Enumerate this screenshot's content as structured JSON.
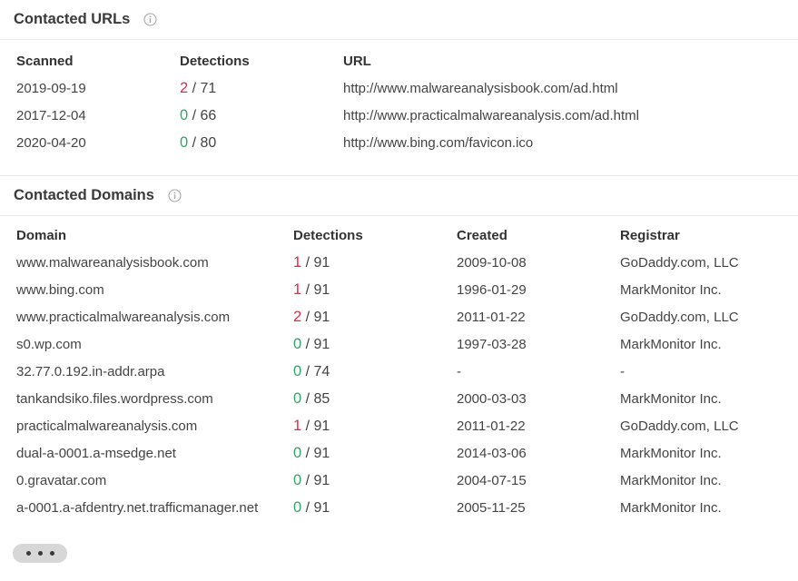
{
  "contacted_urls": {
    "title": "Contacted URLs",
    "headers": {
      "scanned": "Scanned",
      "detections": "Detections",
      "url": "URL"
    },
    "rows": [
      {
        "scanned": "2019-09-19",
        "positives": "2",
        "total": "71",
        "url": "http://www.malwareanalysisbook.com/ad.html"
      },
      {
        "scanned": "2017-12-04",
        "positives": "0",
        "total": "66",
        "url": "http://www.practicalmalwareanalysis.com/ad.html"
      },
      {
        "scanned": "2020-04-20",
        "positives": "0",
        "total": "80",
        "url": "http://www.bing.com/favicon.ico"
      }
    ]
  },
  "contacted_domains": {
    "title": "Contacted Domains",
    "headers": {
      "domain": "Domain",
      "detections": "Detections",
      "created": "Created",
      "registrar": "Registrar"
    },
    "rows": [
      {
        "domain": "www.malwareanalysisbook.com",
        "positives": "1",
        "total": "91",
        "created": "2009-10-08",
        "registrar": "GoDaddy.com, LLC"
      },
      {
        "domain": "www.bing.com",
        "positives": "1",
        "total": "91",
        "created": "1996-01-29",
        "registrar": "MarkMonitor Inc."
      },
      {
        "domain": "www.practicalmalwareanalysis.com",
        "positives": "2",
        "total": "91",
        "created": "2011-01-22",
        "registrar": "GoDaddy.com, LLC"
      },
      {
        "domain": "s0.wp.com",
        "positives": "0",
        "total": "91",
        "created": "1997-03-28",
        "registrar": "MarkMonitor Inc."
      },
      {
        "domain": "32.77.0.192.in-addr.arpa",
        "positives": "0",
        "total": "74",
        "created": "-",
        "registrar": "-"
      },
      {
        "domain": "tankandsiko.files.wordpress.com",
        "positives": "0",
        "total": "85",
        "created": "2000-03-03",
        "registrar": "MarkMonitor Inc."
      },
      {
        "domain": "practicalmalwareanalysis.com",
        "positives": "1",
        "total": "91",
        "created": "2011-01-22",
        "registrar": "GoDaddy.com, LLC"
      },
      {
        "domain": "dual-a-0001.a-msedge.net",
        "positives": "0",
        "total": "91",
        "created": "2014-03-06",
        "registrar": "MarkMonitor Inc."
      },
      {
        "domain": "0.gravatar.com",
        "positives": "0",
        "total": "91",
        "created": "2004-07-15",
        "registrar": "MarkMonitor Inc."
      },
      {
        "domain": "a-0001.a-afdentry.net.trafficmanager.net",
        "positives": "0",
        "total": "91",
        "created": "2005-11-25",
        "registrar": "MarkMonitor Inc."
      }
    ]
  },
  "icons": {
    "info": "info-icon",
    "more": "more-dots-icon"
  },
  "colors": {
    "positive": "#e02a45",
    "clean": "#2ea866"
  },
  "separator": " / "
}
